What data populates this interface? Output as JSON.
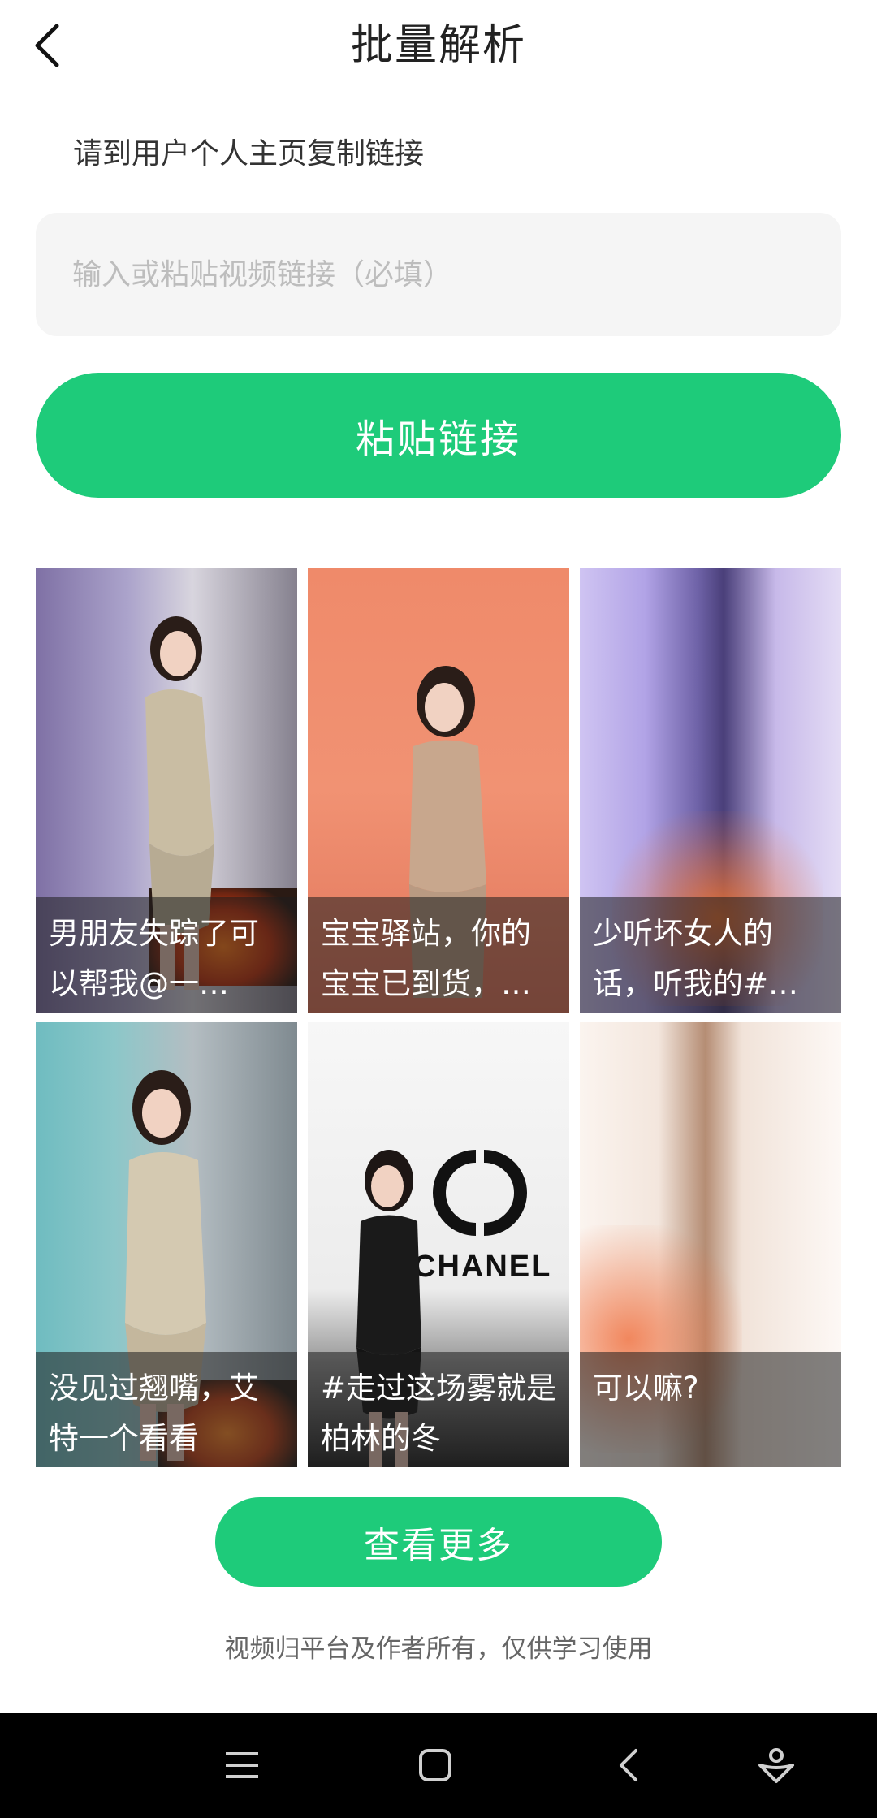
{
  "header": {
    "title": "批量解析"
  },
  "hint": "请到用户个人主页复制链接",
  "url_input": {
    "value": "",
    "placeholder": "输入或粘贴视频链接（必填）"
  },
  "paste_button": "粘贴链接",
  "videos": [
    {
      "caption": "男朋友失踪了可以帮我@一…"
    },
    {
      "caption": "宝宝驿站，你的宝宝已到货，…"
    },
    {
      "caption": "少听坏女人的话，听我的#…"
    },
    {
      "caption": "没见过翘嘴，艾特一个看看"
    },
    {
      "caption": "#走过这场雾就是柏林的冬"
    },
    {
      "caption": "可以嘛?"
    }
  ],
  "thumbnail_brand_text": "CHANEL",
  "more_button": "查看更多",
  "footer_note": "视频归平台及作者所有，仅供学习使用",
  "icons": {
    "back": "chevron-left-icon",
    "nav_menu": "menu-icon",
    "nav_home": "home-square-icon",
    "nav_back": "back-triangle-icon",
    "nav_assist": "assistant-icon"
  },
  "colors": {
    "accent": "#1ecb7a",
    "input_bg": "#f5f5f5",
    "navbar_bg": "#000000"
  }
}
